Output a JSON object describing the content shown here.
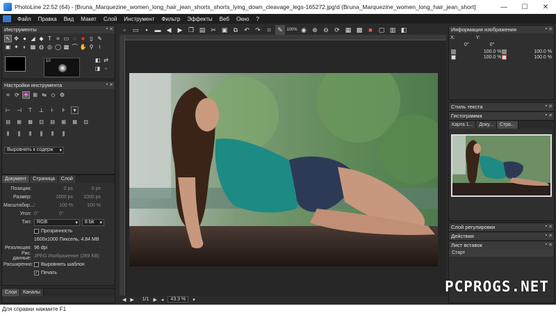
{
  "window": {
    "title": "PhotoLine 22.52 (64) - [Bruna_Marquezine_women_long_hair_jean_shorts_shorts_lying_down_cleavage_legs-165272.jpg!d (Bruna_Marquezine_women_long_hair_jean_short]",
    "minimize": "—",
    "maximize": "☐",
    "close": "✕"
  },
  "menu": [
    "Файл",
    "Правка",
    "Вид",
    "Макет",
    "Слой",
    "Инструмент",
    "Фильтр",
    "Эффекты",
    "Веб",
    "Окно",
    "?"
  ],
  "tools_panel": {
    "title": "Инструменты",
    "brush_size": "10"
  },
  "tool_settings": {
    "title": "Настройки инструмента",
    "align_label": "Выровнять к содерж"
  },
  "doc_panel": {
    "tabs": [
      "Документ",
      "Страница",
      "Слой"
    ],
    "position_label": "Позиция:",
    "position_x": "0 px",
    "position_y": "0 px",
    "size_label": "Размер:",
    "size_w": "1600 px",
    "size_h": "1000 px",
    "scale_label": "Масштабир...:",
    "scale_x": "100 %",
    "scale_y": "100 %",
    "angle_label": "Угол:",
    "angle_1": "0°",
    "angle_2": "0°",
    "type_label": "Тип:",
    "type_value": "RGB",
    "bit_value": "8 bit",
    "transparency": "Прозрачность",
    "dimensions": "1600x1000 Пиксель, 4.84 MB",
    "resolution_label": "Резолюция:",
    "resolution_value": "96 dpi",
    "picdata_label": "Рис. данные:",
    "picdata_value": "JPEG Изображение (269 KB)",
    "extended_label": "Расширенно:",
    "align_template": "Выровнять шаблон",
    "print": "Печать"
  },
  "layers_panel": {
    "tabs": [
      "Слои",
      "Каналы"
    ]
  },
  "image_info": {
    "title": "Информация изображения",
    "x_label": "X:",
    "y_label": "Y:",
    "angle1": "0°",
    "angle2": "0°",
    "val1": "100.0 %",
    "val2": "100.0 %",
    "val3": "100.0 %",
    "val4": "100.0 %"
  },
  "right_panels": {
    "text_style": "Стиль текста",
    "histogram": "Гистограмма",
    "nav_tabs": [
      "Карта 1...",
      "Доку...",
      "Стра..."
    ],
    "adjust_layers": "Слой регулировки",
    "actions": "Действия",
    "clipboard": "Лист вставок",
    "start": "Старт"
  },
  "bottom_bar": {
    "page": "1/1",
    "zoom": "43.3 %"
  },
  "status": "Для справки нажмите F1",
  "watermark": "PCPROGS.NET",
  "toolbar_zoom": "100%"
}
